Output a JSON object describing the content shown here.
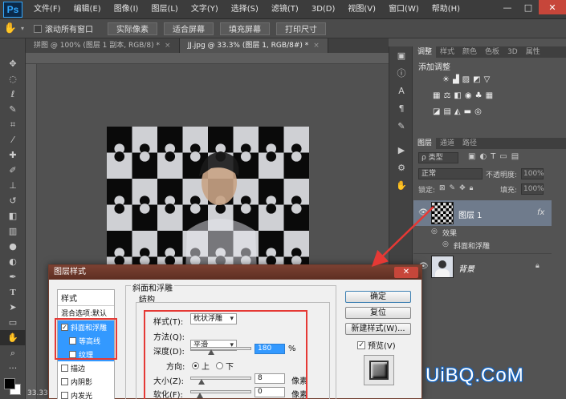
{
  "app": {
    "logo": "Ps",
    "menu": [
      "文件(F)",
      "编辑(E)",
      "图像(I)",
      "图层(L)",
      "文字(Y)",
      "选择(S)",
      "滤镜(T)",
      "3D(D)",
      "视图(V)",
      "窗口(W)",
      "帮助(H)"
    ],
    "window_controls": [
      "—",
      "□",
      "✕"
    ]
  },
  "options_bar": {
    "scroll_all_label": "滚动所有窗口",
    "buttons": [
      "实际像素",
      "适合屏幕",
      "填充屏幕",
      "打印尺寸"
    ]
  },
  "tabs": [
    {
      "label": "拼图 @ 100% (图层 1 副本, RGB/8) *",
      "active": false
    },
    {
      "label": "JJ.jpg @ 33.3% (图层 1, RGB/8#) *",
      "active": true
    }
  ],
  "status": {
    "zoom": "33.33"
  },
  "adjustments_panel": {
    "tabs": [
      "调整",
      "样式",
      "颜色",
      "色板",
      "3D",
      "属性"
    ],
    "title": "添加调整"
  },
  "layers_panel": {
    "tabs": [
      "图层",
      "通道",
      "路径"
    ],
    "filter_label": "ρ 类型",
    "blend_mode": "正常",
    "opacity_label": "不透明度:",
    "opacity_value": "100%",
    "lock_label": "锁定:",
    "fill_label": "填充:",
    "fill_value": "100%",
    "layers": [
      {
        "name": "图层 1",
        "fx": "fx",
        "effects_label": "效果",
        "effect": "斜面和浮雕"
      },
      {
        "name": "背景"
      }
    ]
  },
  "dialog": {
    "title": "图层样式",
    "close": "✕",
    "styles_header": "样式",
    "blend_options": "混合选项:默认",
    "style_items": [
      {
        "label": "斜面和浮雕",
        "checked": true,
        "selected": true
      },
      {
        "label": "等高线",
        "checked": false,
        "selected": true
      },
      {
        "label": "纹理",
        "checked": false,
        "selected": true
      },
      {
        "label": "描边",
        "checked": false,
        "selected": false
      },
      {
        "label": "内阴影",
        "checked": false,
        "selected": false
      },
      {
        "label": "内发光",
        "checked": false,
        "selected": false
      }
    ],
    "section_title": "斜面和浮雕",
    "group_title": "结构",
    "style_label": "样式(T):",
    "style_value": "枕状浮雕",
    "technique_label": "方法(Q):",
    "technique_value": "平滑",
    "depth_label": "深度(D):",
    "depth_value": "180",
    "depth_unit": "%",
    "depth_fraction": 0.18,
    "direction_label": "方向:",
    "direction_up": "上",
    "direction_down": "下",
    "size_label": "大小(Z):",
    "size_value": "8",
    "size_unit": "像素",
    "size_fraction": 0.03,
    "soften_label": "软化(F):",
    "soften_value": "0",
    "soften_unit": "像素",
    "soften_fraction": 0.0,
    "buttons": {
      "ok": "确定",
      "reset": "复位",
      "new_style": "新建样式(W)...",
      "preview": "预览(V)"
    }
  },
  "watermark": "UiBQ.CoM",
  "colors": {
    "accent_red": "#e53935",
    "selection_blue": "#3399ff"
  }
}
